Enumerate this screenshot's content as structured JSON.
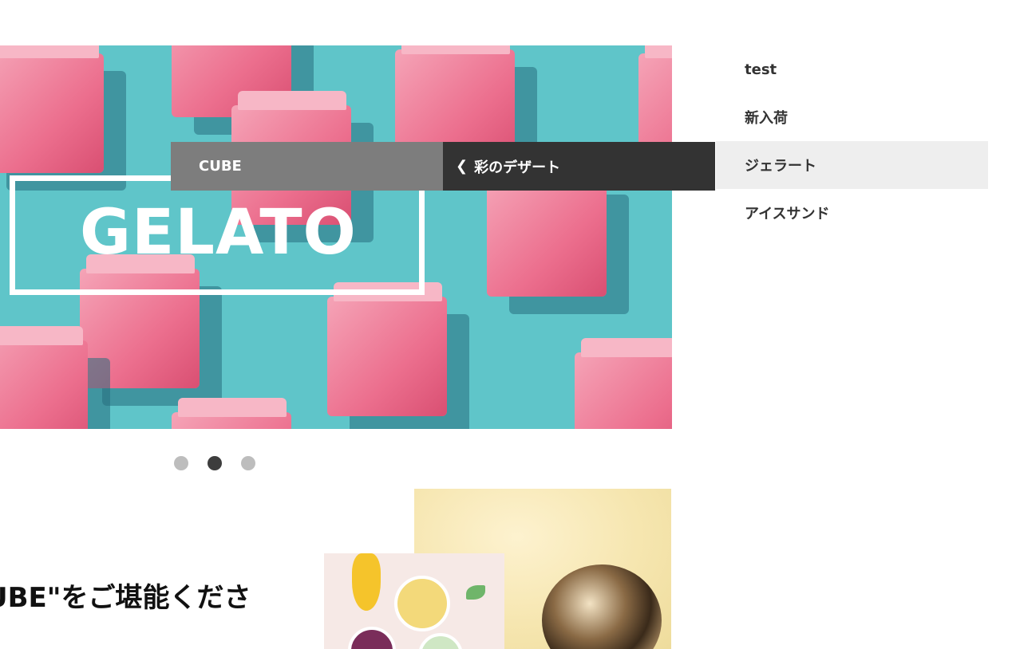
{
  "hero": {
    "banner_text": "GELATO",
    "dots": [
      {
        "active": false
      },
      {
        "active": true
      },
      {
        "active": false
      }
    ]
  },
  "breadcrumb": {
    "root_label": "CUBE",
    "back_icon": "chevron-left-icon",
    "current_label": "彩のデザート"
  },
  "sidebar": {
    "items": [
      {
        "label": "test",
        "active": false
      },
      {
        "label": "新入荷",
        "active": false
      },
      {
        "label": "ジェラート",
        "active": true
      },
      {
        "label": "アイスサンド",
        "active": false
      }
    ]
  },
  "content": {
    "tagline": "UBE\"をご堪能くださ"
  },
  "colors": {
    "hero_background": "#5fc5c9",
    "crumb_root_bg": "#7d7d7d",
    "crumb_current_bg": "#333333",
    "sidebar_active_bg": "#eeeeee",
    "dot_active": "#3d3d3d",
    "dot_inactive": "#bdbdbd"
  }
}
